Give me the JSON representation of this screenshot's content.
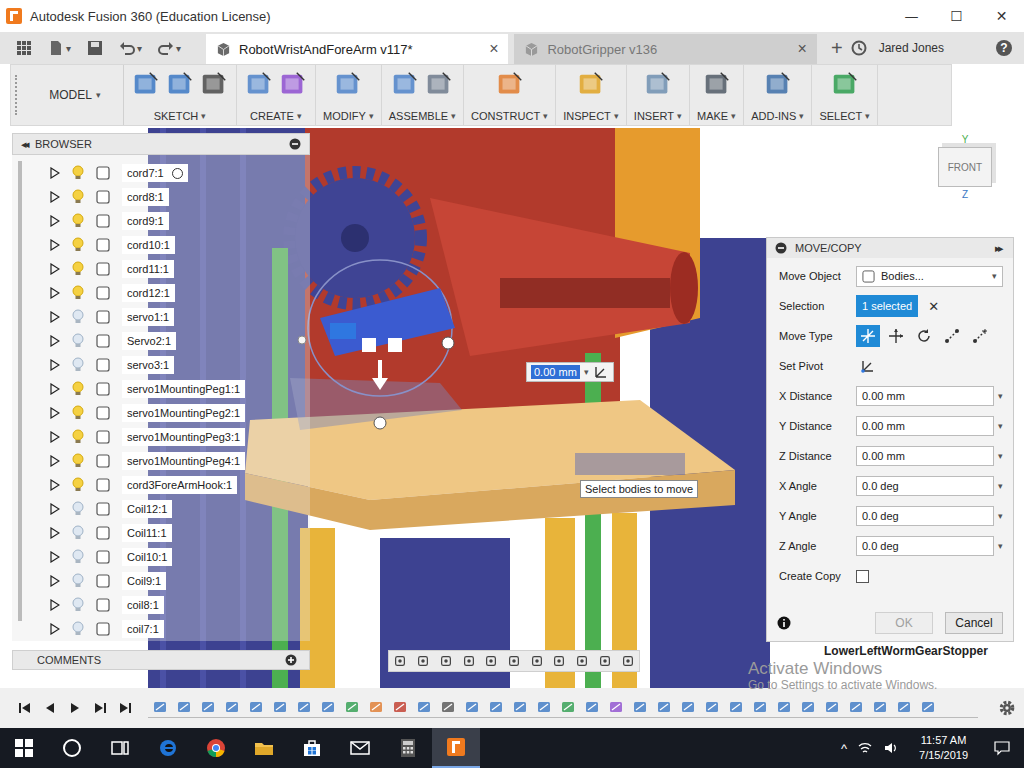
{
  "window": {
    "title": "Autodesk Fusion 360 (Education License)",
    "controls": [
      "—",
      "☐",
      "✕"
    ]
  },
  "caret": "▾",
  "quick_access": {
    "new_tab": "+",
    "user": "Jared Jones",
    "help": "?"
  },
  "tabs": [
    {
      "label": "RobotWristAndForeArm v117*",
      "selected": true,
      "close": "×"
    },
    {
      "label": "RobotGripper v136",
      "selected": false,
      "close": "×"
    }
  ],
  "workspace": {
    "label": "MODEL"
  },
  "toolbar": [
    {
      "label": "SKETCH"
    },
    {
      "label": "CREATE"
    },
    {
      "label": "MODIFY"
    },
    {
      "label": "ASSEMBLE"
    },
    {
      "label": "CONSTRUCT"
    },
    {
      "label": "INSPECT"
    },
    {
      "label": "INSERT"
    },
    {
      "label": "MAKE"
    },
    {
      "label": "ADD-INS"
    },
    {
      "label": "SELECT"
    }
  ],
  "browser": {
    "title": "BROWSER",
    "collapse": "◂◂",
    "items": [
      {
        "name": "cord7:1",
        "visible": true,
        "expanded": false,
        "hovered": true
      },
      {
        "name": "cord8:1",
        "visible": true,
        "expanded": false,
        "hovered": false
      },
      {
        "name": "cord9:1",
        "visible": true,
        "expanded": false,
        "hovered": false
      },
      {
        "name": "cord10:1",
        "visible": true,
        "expanded": false,
        "hovered": false
      },
      {
        "name": "cord11:1",
        "visible": true,
        "expanded": false,
        "hovered": false
      },
      {
        "name": "cord12:1",
        "visible": true,
        "expanded": false,
        "hovered": false
      },
      {
        "name": "servo1:1",
        "visible": false,
        "expanded": false,
        "hovered": false
      },
      {
        "name": "Servo2:1",
        "visible": false,
        "expanded": false,
        "hovered": false
      },
      {
        "name": "servo3:1",
        "visible": false,
        "expanded": false,
        "hovered": false
      },
      {
        "name": "servo1MountingPeg1:1",
        "visible": true,
        "expanded": false,
        "hovered": false
      },
      {
        "name": "servo1MountingPeg2:1",
        "visible": true,
        "expanded": false,
        "hovered": false
      },
      {
        "name": "servo1MountingPeg3:1",
        "visible": true,
        "expanded": false,
        "hovered": false
      },
      {
        "name": "servo1MountingPeg4:1",
        "visible": true,
        "expanded": false,
        "hovered": false
      },
      {
        "name": "cord3ForeArmHook:1",
        "visible": true,
        "expanded": false,
        "hovered": false
      },
      {
        "name": "Coil12:1",
        "visible": false,
        "expanded": false,
        "hovered": false
      },
      {
        "name": "Coil11:1",
        "visible": false,
        "expanded": false,
        "hovered": false
      },
      {
        "name": "Coil10:1",
        "visible": false,
        "expanded": false,
        "hovered": false
      },
      {
        "name": "Coil9:1",
        "visible": false,
        "expanded": false,
        "hovered": false
      },
      {
        "name": "coil8:1",
        "visible": false,
        "expanded": false,
        "hovered": false
      },
      {
        "name": "coil7:1",
        "visible": false,
        "expanded": false,
        "hovered": false
      }
    ]
  },
  "comments": {
    "title": "COMMENTS"
  },
  "move_copy": {
    "title": "MOVE/COPY",
    "expand": "▸▸",
    "rows": [
      {
        "kind": "dropdown",
        "label": "Move Object",
        "value": "Bodies..."
      },
      {
        "kind": "selection",
        "label": "Selection",
        "value": "1 selected",
        "clear": "✕"
      },
      {
        "kind": "types",
        "label": "Move Type",
        "options": [
          {
            "kind": "free",
            "selected": true
          },
          {
            "kind": "translate",
            "selected": false
          },
          {
            "kind": "rotate",
            "selected": false
          },
          {
            "kind": "point",
            "selected": false
          },
          {
            "kind": "point-to-position",
            "selected": false
          }
        ]
      },
      {
        "kind": "pivot",
        "label": "Set Pivot"
      },
      {
        "kind": "input",
        "label": "X Distance",
        "value": "0.00 mm"
      },
      {
        "kind": "input",
        "label": "Y Distance",
        "value": "0.00 mm"
      },
      {
        "kind": "input",
        "label": "Z Distance",
        "value": "0.00 mm"
      },
      {
        "kind": "input",
        "label": "X Angle",
        "value": "0.0 deg"
      },
      {
        "kind": "input",
        "label": "Y Angle",
        "value": "0.0 deg"
      },
      {
        "kind": "input",
        "label": "Z Angle",
        "value": "0.0 deg"
      },
      {
        "kind": "checkbox",
        "label": "Create Copy",
        "checked": false
      }
    ],
    "buttons": [
      {
        "label": "OK",
        "disabled": true
      },
      {
        "label": "Cancel",
        "disabled": false
      }
    ]
  },
  "canvas": {
    "dimension_input": "0.00 mm",
    "tooltip": "Select bodies to move",
    "selection_label": "LowerLeftWormGearStopper",
    "viewcube": {
      "face": "FRONT",
      "axis_up": "Y",
      "axis_down": "Z"
    }
  },
  "watermark": {
    "title": "Activate Windows",
    "subtitle": "Go to Settings to activate Windows."
  },
  "taskbar": {
    "apps": [
      {
        "kind": "start",
        "active": false
      },
      {
        "kind": "search",
        "active": false
      },
      {
        "kind": "task-view",
        "active": false
      },
      {
        "kind": "edge",
        "active": false
      },
      {
        "kind": "chrome",
        "active": false
      },
      {
        "kind": "explorer",
        "active": false
      },
      {
        "kind": "store",
        "active": false
      },
      {
        "kind": "mail",
        "active": false
      },
      {
        "kind": "calculator",
        "active": false
      },
      {
        "kind": "fusion",
        "active": true
      }
    ],
    "tray_caret": "^",
    "time": "11:57 AM",
    "date": "7/15/2019"
  }
}
